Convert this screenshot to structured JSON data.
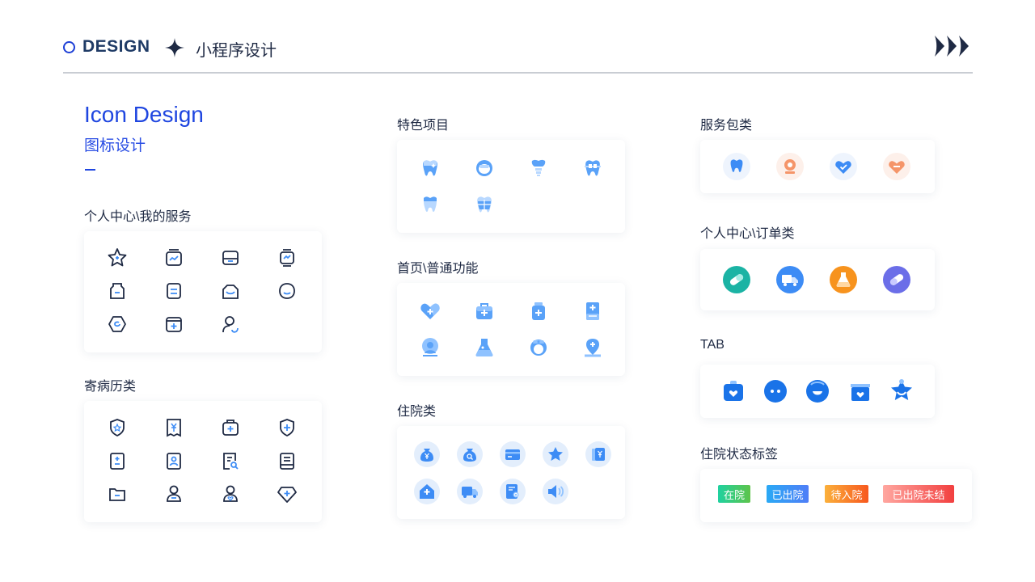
{
  "header": {
    "design_label": "DESIGN",
    "subtitle": "小程序设计"
  },
  "intro": {
    "title": "Icon Design",
    "subtitle": "图标设计"
  },
  "sections": {
    "personal_service": {
      "title": "个人中心\\我的服务"
    },
    "medical_record": {
      "title": "寄病历类"
    },
    "featured": {
      "title": "特色项目"
    },
    "home_functions": {
      "title": "首页\\普通功能"
    },
    "hospitalization": {
      "title": "住院类"
    },
    "service_package": {
      "title": "服务包类"
    },
    "personal_orders": {
      "title": "个人中心\\订单类"
    },
    "tab": {
      "title": "TAB"
    },
    "status_tags": {
      "title": "住院状态标签"
    }
  },
  "tags": {
    "in_hospital": "在院",
    "discharged": "已出院",
    "to_admit": "待入院",
    "discharged_unsettled": "已出院未结"
  },
  "colors": {
    "accent_blue": "#1f46e0",
    "navy": "#1f3b66",
    "icon_blue": "#3d8cf5",
    "icon_light": "#dbeafe",
    "teal": "#1bb3a4",
    "orange": "#f7931e",
    "purple": "#6b6ee8",
    "green_tag": "#2ecc71",
    "blue_tag": "#3b8cf7",
    "orange_tag": "#f7941d",
    "red_tag": "#f25c5c"
  }
}
